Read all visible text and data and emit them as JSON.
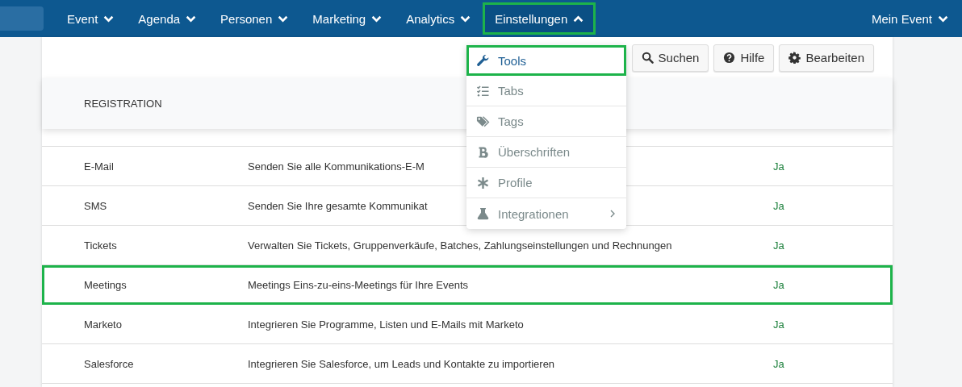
{
  "nav": {
    "items": [
      {
        "label": "Event",
        "expanded": false,
        "highlighted": false
      },
      {
        "label": "Agenda",
        "expanded": false,
        "highlighted": false
      },
      {
        "label": "Personen",
        "expanded": false,
        "highlighted": false
      },
      {
        "label": "Marketing",
        "expanded": false,
        "highlighted": false
      },
      {
        "label": "Analytics",
        "expanded": false,
        "highlighted": false
      },
      {
        "label": "Einstellungen",
        "expanded": true,
        "highlighted": true
      }
    ],
    "right": {
      "label": "Mein Event",
      "expanded": false
    }
  },
  "toolbar": {
    "buttons": [
      {
        "label": "Suchen"
      },
      {
        "label": "Hilfe"
      },
      {
        "label": "Bearbeiten"
      }
    ]
  },
  "table": {
    "header": "REGISTRATION",
    "rows": [
      {
        "name": "E-Mail",
        "description": "Senden Sie alle Kommunikations-E-M",
        "value": "Ja",
        "highlighted": false
      },
      {
        "name": "SMS",
        "description": "Senden Sie Ihre gesamte Kommunikat",
        "value": "Ja",
        "highlighted": false
      },
      {
        "name": "Tickets",
        "description": "Verwalten Sie Tickets, Gruppenverkäufe, Batches, Zahlungseinstellungen und Rechnungen",
        "value": "Ja",
        "highlighted": false
      },
      {
        "name": "Meetings",
        "description": "Meetings Eins-zu-eins-Meetings für Ihre Events",
        "value": "Ja",
        "highlighted": true
      },
      {
        "name": "Marketo",
        "description": "Integrieren Sie Programme, Listen und E-Mails mit Marketo",
        "value": "Ja",
        "highlighted": false
      },
      {
        "name": "Salesforce",
        "description": "Integrieren Sie Salesforce, um Leads und Kontakte zu importieren",
        "value": "Ja",
        "highlighted": false
      }
    ]
  },
  "dropdown": {
    "items": [
      {
        "label": "Tools",
        "selected": true,
        "submenu": false
      },
      {
        "label": "Tabs",
        "selected": false,
        "submenu": false
      },
      {
        "label": "Tags",
        "selected": false,
        "submenu": false
      },
      {
        "label": "Überschriften",
        "selected": false,
        "submenu": false
      },
      {
        "label": "Profile",
        "selected": false,
        "submenu": false
      },
      {
        "label": "Integrationen",
        "selected": false,
        "submenu": true
      }
    ]
  }
}
